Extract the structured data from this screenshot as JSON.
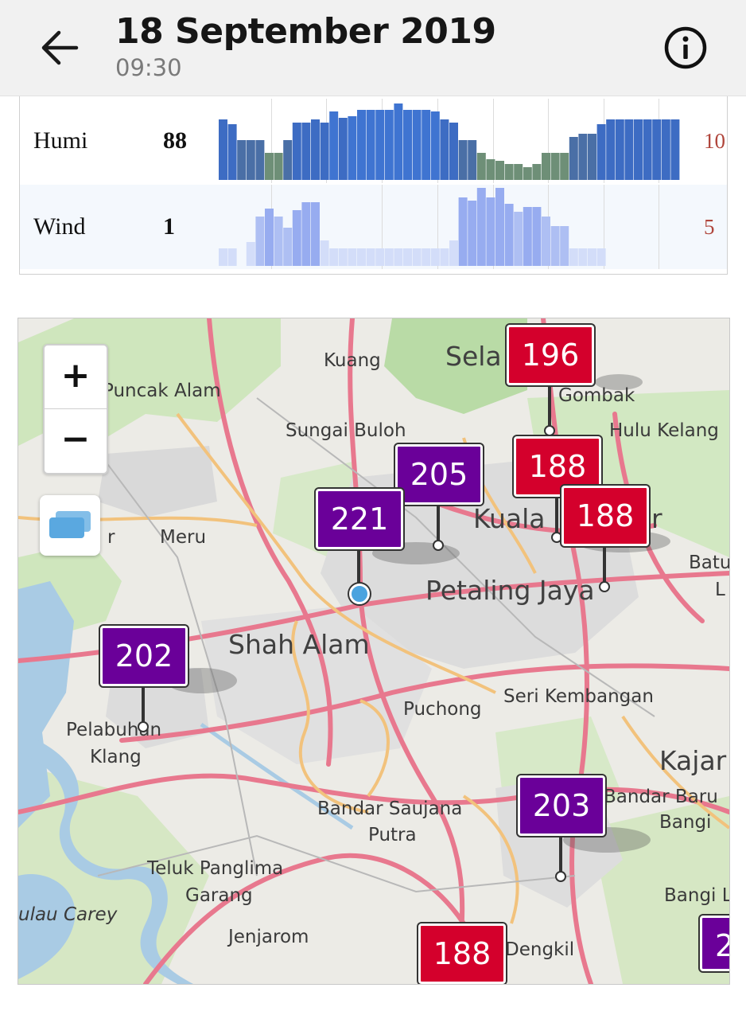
{
  "header": {
    "title": "18 September 2019",
    "subtitle": "09:30",
    "back_icon": "arrow-left-icon",
    "info_icon": "info-circle-icon"
  },
  "weather": {
    "humi": {
      "label": "Humi",
      "value": "88",
      "max": "10"
    },
    "wind": {
      "label": "Wind",
      "value": "1",
      "max": "5"
    }
  },
  "map": {
    "zoom_in": "+",
    "zoom_out": "−",
    "layers_icon": "layers-icon",
    "places": {
      "kuang": "Kuang",
      "selayang": "Sela",
      "puncak_alam": "Puncak Alam",
      "gombak": "Gombak",
      "sungai_buloh": "Sungai Buloh",
      "hulu_kelang": "Hulu Kelang",
      "kuala": "Kuala",
      "kuala_r": "r",
      "meru": "Meru",
      "meru_r": "r",
      "batu": "Batu",
      "batu_l": "L",
      "petaling_jaya": "Petaling Jaya",
      "shah_alam": "Shah Alam",
      "puchong": "Puchong",
      "seri_kembangan": "Seri Kembangan",
      "pelabuhan": "Pelabuhan",
      "klang": "Klang",
      "kajang": "Kajar",
      "bandar_baru": "Bandar Baru",
      "bangi": "Bangi",
      "bandar_saujana": "Bandar Saujana",
      "putra": "Putra",
      "teluk_panglima": "Teluk Panglima",
      "garang": "Garang",
      "pulau_carey": "ulau Carey",
      "bangi_lama": "Bangi La",
      "jenjarom": "Jenjarom",
      "dengkil": "Dengkil"
    },
    "markers": [
      {
        "value": "196",
        "color": "#d4002c"
      },
      {
        "value": "205",
        "color": "#6a0099"
      },
      {
        "value": "188",
        "color": "#d4002c"
      },
      {
        "value": "221",
        "color": "#6a0099"
      },
      {
        "value": "188",
        "color": "#d4002c"
      },
      {
        "value": "202",
        "color": "#6a0099"
      },
      {
        "value": "203",
        "color": "#6a0099"
      },
      {
        "value": "188",
        "color": "#d4002c"
      },
      {
        "value": "2",
        "color": "#6a0099"
      }
    ]
  }
}
